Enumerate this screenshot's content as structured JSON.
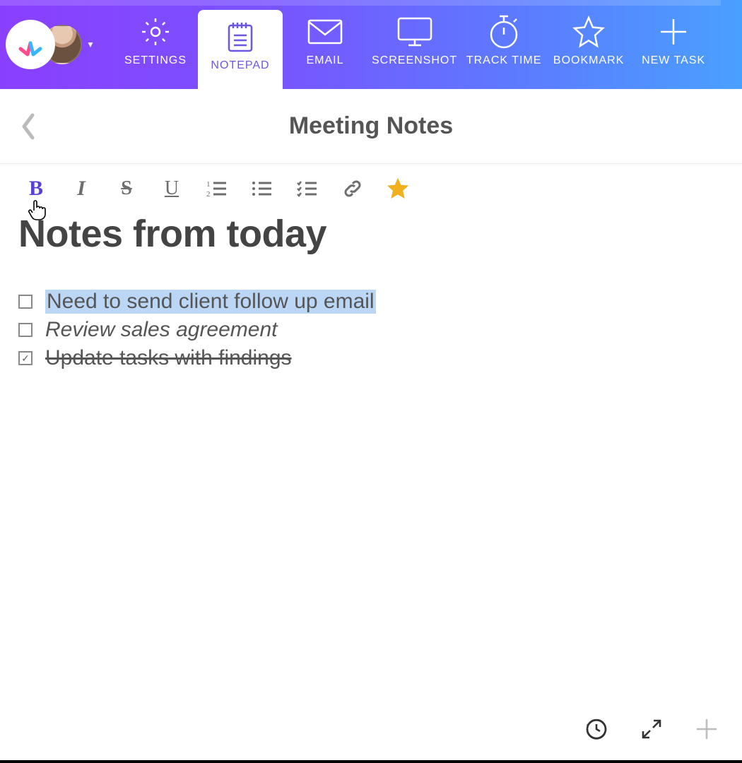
{
  "nav": {
    "items": [
      {
        "label": "SETTINGS",
        "icon": "gear-icon"
      },
      {
        "label": "NOTEPAD",
        "icon": "notepad-icon",
        "active": true
      },
      {
        "label": "EMAIL",
        "icon": "mail-icon"
      },
      {
        "label": "SCREENSHOT",
        "icon": "monitor-icon"
      },
      {
        "label": "TRACK TIME",
        "icon": "stopwatch-icon"
      },
      {
        "label": "BOOKMARK",
        "icon": "star-icon"
      },
      {
        "label": "NEW TASK",
        "icon": "plus-icon"
      }
    ]
  },
  "titlebar": {
    "title": "Meeting Notes"
  },
  "format_toolbar": {
    "buttons": [
      {
        "name": "bold",
        "glyph": "B",
        "active": true
      },
      {
        "name": "italic",
        "glyph": "I"
      },
      {
        "name": "strikethrough",
        "glyph": "S"
      },
      {
        "name": "underline",
        "glyph": "U"
      },
      {
        "name": "ordered-list"
      },
      {
        "name": "unordered-list"
      },
      {
        "name": "checklist"
      },
      {
        "name": "link"
      },
      {
        "name": "favorite",
        "starred": true
      }
    ]
  },
  "document": {
    "heading": "Notes from today",
    "items": [
      {
        "text": "Need to send client follow up email",
        "checked": false,
        "highlighted": true
      },
      {
        "text": "Review sales agreement",
        "checked": false,
        "italic": true
      },
      {
        "text": "Update tasks with findings",
        "checked": true,
        "strike": true
      }
    ]
  },
  "bottom_actions": [
    {
      "name": "history"
    },
    {
      "name": "expand"
    },
    {
      "name": "add"
    }
  ]
}
